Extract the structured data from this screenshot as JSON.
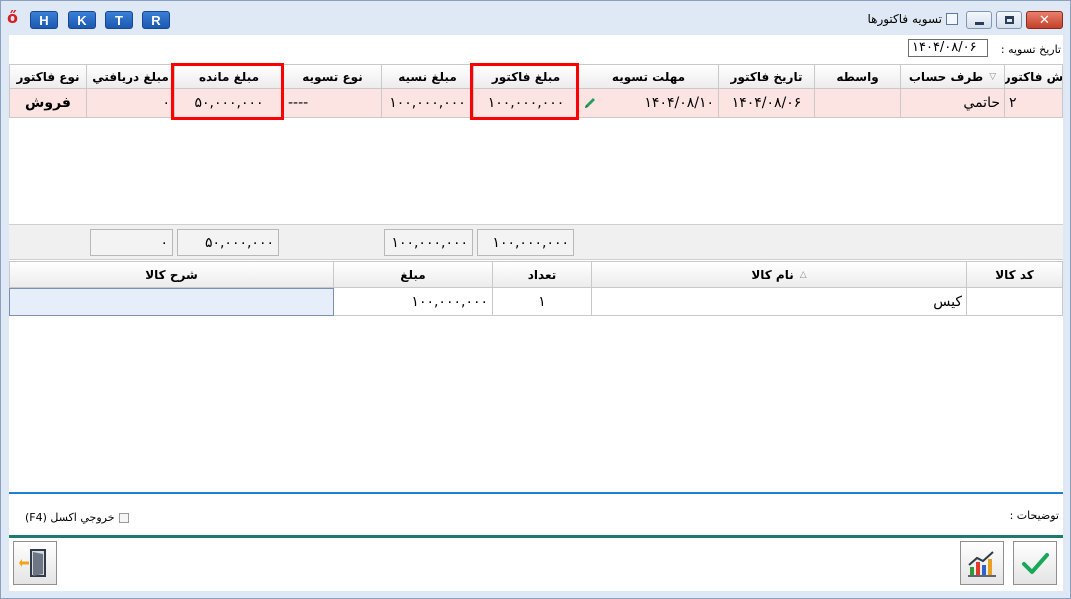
{
  "app": {
    "title": "تسويه فاكتورها",
    "quick_buttons": [
      "H",
      "K",
      "T",
      "R"
    ]
  },
  "settlement_date": {
    "label": "تاريخ تسويه :",
    "value": "۱۴۰۴/۰۸/۰۶"
  },
  "invoices": {
    "columns": [
      "ش فاكتور",
      "طرف حساب",
      "واسطه",
      "تاريخ فاكتور",
      "مهلت تسويه",
      "مبلغ فاكتور",
      "مبلغ نسيه",
      "نوع تسويه",
      "مبلغ مانده",
      "مبلغ دريافتي",
      "نوع فاكتور"
    ],
    "rows": [
      {
        "invoice_no": "۲",
        "party": "حاتمي",
        "agent": "",
        "invoice_date": "۱۴۰۴/۰۸/۰۶",
        "due_date": "۱۴۰۴/۰۸/۱۰",
        "invoice_amount": "۱۰۰,۰۰۰,۰۰۰",
        "credit_amount": "۱۰۰,۰۰۰,۰۰۰",
        "settlement_type": "----",
        "remaining_amount": "۵۰,۰۰۰,۰۰۰",
        "received_amount": "۰",
        "invoice_type": "فروش"
      }
    ]
  },
  "totals": {
    "invoice_amount": "۱۰۰,۰۰۰,۰۰۰",
    "credit_amount": "۱۰۰,۰۰۰,۰۰۰",
    "remaining_amount": "۵۰,۰۰۰,۰۰۰",
    "received_amount": "۰"
  },
  "items": {
    "columns": [
      "كد كالا",
      "نام كالا",
      "تعداد",
      "مبلغ",
      "شرح كالا"
    ],
    "rows": [
      {
        "code": "",
        "name": "كيس",
        "quantity": "۱",
        "amount": "۱۰۰,۰۰۰,۰۰۰",
        "description": ""
      }
    ]
  },
  "notes_label": "توضيحات :",
  "excel_export_label": "خروجي اكسل (F4)",
  "colors": {
    "highlight": "#ff0000",
    "row_pink": "#fbe4e1",
    "separator": "#1f7fd0",
    "footer_separator": "#1d7a73",
    "confirm": "#18a85a"
  }
}
